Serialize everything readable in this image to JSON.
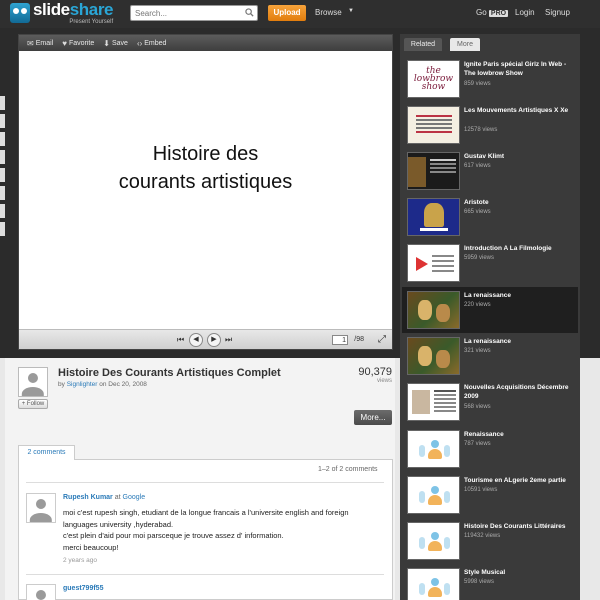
{
  "header": {
    "logo_word_a": "slide",
    "logo_word_b": "share",
    "tagline": "Present Yourself",
    "search_placeholder": "Search...",
    "upload_label": "Upload",
    "browse_label": "Browse",
    "go_label": "Go",
    "pro_label": "PRO",
    "login_label": "Login",
    "signup_label": "Signup"
  },
  "player": {
    "toolbar": {
      "email": "Email",
      "favorite": "Favorite",
      "save": "Save",
      "embed": "Embed"
    },
    "slide_title_line1": "Histoire des",
    "slide_title_line2": "courants artistiques",
    "current_page": "1",
    "total_pages": "/98"
  },
  "deck": {
    "title": "Histoire Des Courants Artistiques Complet",
    "by_prefix": "by",
    "author": "Signlighter",
    "on_text": "on Dec 20, 2008",
    "views_count": "90,379",
    "views_label": "views",
    "follow_label": "+ Follow",
    "more_label": "More..."
  },
  "comments": {
    "tab_label": "2 comments",
    "range_text": "1–2 of 2 comments",
    "items": [
      {
        "author": "Rupesh Kumar",
        "at_text": "at",
        "org": "Google",
        "lines": [
          "moi c'est rupesh singh, etudiant de la longue francais a l'universite english and foreign",
          "languages university ,hyderabad.",
          "c'est plein d'aid pour moi parsceque je trouve assez d' information.",
          "merci beaucoup!"
        ],
        "time": "2 years ago"
      },
      {
        "author": "guest799f55"
      }
    ]
  },
  "sidebar": {
    "tab_related": "Related",
    "tab_more": "More",
    "thumb_lowbrow_text": "the lowbrow show",
    "items": [
      {
        "title": "Ignite Paris spécial Girlz In Web - The lowbrow Show",
        "views": "859 views",
        "thumb": "lowbrow"
      },
      {
        "title": "Les Mouvements Artistiques X Xe",
        "views": "12578 views",
        "thumb": "mouv"
      },
      {
        "title": "Gustav Klimt",
        "views": "617 views",
        "thumb": "klimt"
      },
      {
        "title": "Aristote",
        "views": "665 views",
        "thumb": "aristote"
      },
      {
        "title": "Introduction A La Filmologie",
        "views": "5959 views",
        "thumb": "filmo"
      },
      {
        "title": "La renaissance",
        "views": "220 views",
        "thumb": "paint"
      },
      {
        "title": "La renaissance",
        "views": "321 views",
        "thumb": "paint"
      },
      {
        "title": "Nouvelles Acquisitions Décembre 2009",
        "views": "568 views",
        "thumb": "doc"
      },
      {
        "title": "Renaissance",
        "views": "787 views",
        "thumb": "placeholder"
      },
      {
        "title": "Tourisme en ALgerie 2eme partie",
        "views": "10591 views",
        "thumb": "placeholder"
      },
      {
        "title": "Histoire Des Courants Littéraires",
        "views": "119432 views",
        "thumb": "placeholder"
      },
      {
        "title": "Style Musical",
        "views": "5998 views",
        "thumb": "placeholder"
      }
    ]
  }
}
